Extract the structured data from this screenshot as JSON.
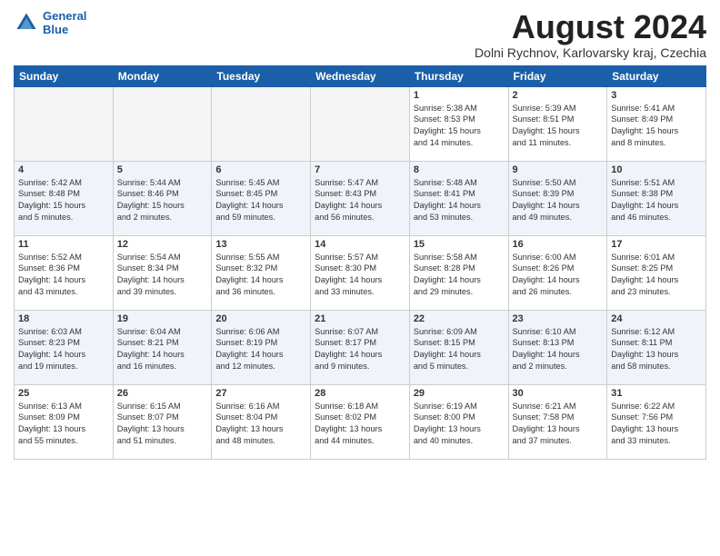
{
  "header": {
    "logo_line1": "General",
    "logo_line2": "Blue",
    "month_year": "August 2024",
    "location": "Dolni Rychnov, Karlovarsky kraj, Czechia"
  },
  "weekdays": [
    "Sunday",
    "Monday",
    "Tuesday",
    "Wednesday",
    "Thursday",
    "Friday",
    "Saturday"
  ],
  "weeks": [
    [
      {
        "day": "",
        "info": ""
      },
      {
        "day": "",
        "info": ""
      },
      {
        "day": "",
        "info": ""
      },
      {
        "day": "",
        "info": ""
      },
      {
        "day": "1",
        "info": "Sunrise: 5:38 AM\nSunset: 8:53 PM\nDaylight: 15 hours\nand 14 minutes."
      },
      {
        "day": "2",
        "info": "Sunrise: 5:39 AM\nSunset: 8:51 PM\nDaylight: 15 hours\nand 11 minutes."
      },
      {
        "day": "3",
        "info": "Sunrise: 5:41 AM\nSunset: 8:49 PM\nDaylight: 15 hours\nand 8 minutes."
      }
    ],
    [
      {
        "day": "4",
        "info": "Sunrise: 5:42 AM\nSunset: 8:48 PM\nDaylight: 15 hours\nand 5 minutes."
      },
      {
        "day": "5",
        "info": "Sunrise: 5:44 AM\nSunset: 8:46 PM\nDaylight: 15 hours\nand 2 minutes."
      },
      {
        "day": "6",
        "info": "Sunrise: 5:45 AM\nSunset: 8:45 PM\nDaylight: 14 hours\nand 59 minutes."
      },
      {
        "day": "7",
        "info": "Sunrise: 5:47 AM\nSunset: 8:43 PM\nDaylight: 14 hours\nand 56 minutes."
      },
      {
        "day": "8",
        "info": "Sunrise: 5:48 AM\nSunset: 8:41 PM\nDaylight: 14 hours\nand 53 minutes."
      },
      {
        "day": "9",
        "info": "Sunrise: 5:50 AM\nSunset: 8:39 PM\nDaylight: 14 hours\nand 49 minutes."
      },
      {
        "day": "10",
        "info": "Sunrise: 5:51 AM\nSunset: 8:38 PM\nDaylight: 14 hours\nand 46 minutes."
      }
    ],
    [
      {
        "day": "11",
        "info": "Sunrise: 5:52 AM\nSunset: 8:36 PM\nDaylight: 14 hours\nand 43 minutes."
      },
      {
        "day": "12",
        "info": "Sunrise: 5:54 AM\nSunset: 8:34 PM\nDaylight: 14 hours\nand 39 minutes."
      },
      {
        "day": "13",
        "info": "Sunrise: 5:55 AM\nSunset: 8:32 PM\nDaylight: 14 hours\nand 36 minutes."
      },
      {
        "day": "14",
        "info": "Sunrise: 5:57 AM\nSunset: 8:30 PM\nDaylight: 14 hours\nand 33 minutes."
      },
      {
        "day": "15",
        "info": "Sunrise: 5:58 AM\nSunset: 8:28 PM\nDaylight: 14 hours\nand 29 minutes."
      },
      {
        "day": "16",
        "info": "Sunrise: 6:00 AM\nSunset: 8:26 PM\nDaylight: 14 hours\nand 26 minutes."
      },
      {
        "day": "17",
        "info": "Sunrise: 6:01 AM\nSunset: 8:25 PM\nDaylight: 14 hours\nand 23 minutes."
      }
    ],
    [
      {
        "day": "18",
        "info": "Sunrise: 6:03 AM\nSunset: 8:23 PM\nDaylight: 14 hours\nand 19 minutes."
      },
      {
        "day": "19",
        "info": "Sunrise: 6:04 AM\nSunset: 8:21 PM\nDaylight: 14 hours\nand 16 minutes."
      },
      {
        "day": "20",
        "info": "Sunrise: 6:06 AM\nSunset: 8:19 PM\nDaylight: 14 hours\nand 12 minutes."
      },
      {
        "day": "21",
        "info": "Sunrise: 6:07 AM\nSunset: 8:17 PM\nDaylight: 14 hours\nand 9 minutes."
      },
      {
        "day": "22",
        "info": "Sunrise: 6:09 AM\nSunset: 8:15 PM\nDaylight: 14 hours\nand 5 minutes."
      },
      {
        "day": "23",
        "info": "Sunrise: 6:10 AM\nSunset: 8:13 PM\nDaylight: 14 hours\nand 2 minutes."
      },
      {
        "day": "24",
        "info": "Sunrise: 6:12 AM\nSunset: 8:11 PM\nDaylight: 13 hours\nand 58 minutes."
      }
    ],
    [
      {
        "day": "25",
        "info": "Sunrise: 6:13 AM\nSunset: 8:09 PM\nDaylight: 13 hours\nand 55 minutes."
      },
      {
        "day": "26",
        "info": "Sunrise: 6:15 AM\nSunset: 8:07 PM\nDaylight: 13 hours\nand 51 minutes."
      },
      {
        "day": "27",
        "info": "Sunrise: 6:16 AM\nSunset: 8:04 PM\nDaylight: 13 hours\nand 48 minutes."
      },
      {
        "day": "28",
        "info": "Sunrise: 6:18 AM\nSunset: 8:02 PM\nDaylight: 13 hours\nand 44 minutes."
      },
      {
        "day": "29",
        "info": "Sunrise: 6:19 AM\nSunset: 8:00 PM\nDaylight: 13 hours\nand 40 minutes."
      },
      {
        "day": "30",
        "info": "Sunrise: 6:21 AM\nSunset: 7:58 PM\nDaylight: 13 hours\nand 37 minutes."
      },
      {
        "day": "31",
        "info": "Sunrise: 6:22 AM\nSunset: 7:56 PM\nDaylight: 13 hours\nand 33 minutes."
      }
    ]
  ]
}
